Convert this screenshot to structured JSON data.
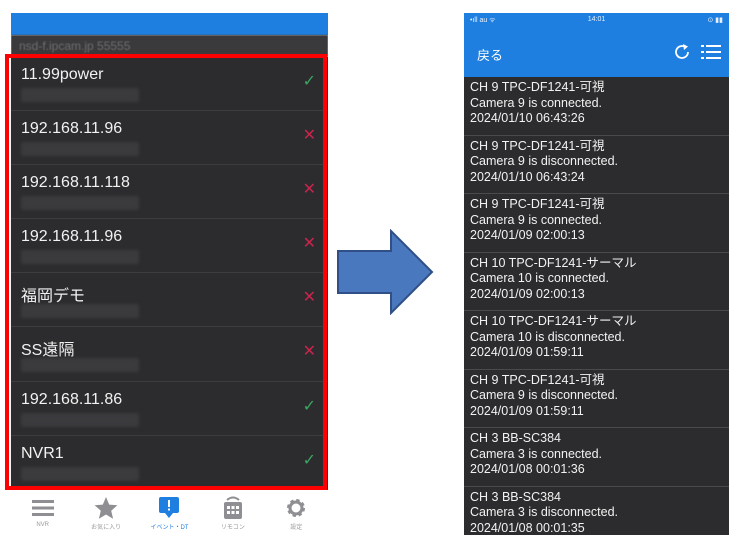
{
  "left_app": {
    "server_address": "nsd-f.ipcam.jp 55555",
    "devices": [
      {
        "name": "11.99power",
        "status": "connected",
        "status_glyph": "✓"
      },
      {
        "name": "192.168.11.96",
        "status": "disconnected",
        "status_glyph": "✕"
      },
      {
        "name": "192.168.11.118",
        "status": "disconnected",
        "status_glyph": "✕"
      },
      {
        "name": "192.168.11.96",
        "status": "disconnected",
        "status_glyph": "✕"
      },
      {
        "name": "福岡デモ",
        "status": "disconnected",
        "status_glyph": "✕"
      },
      {
        "name": "SS遠隔",
        "status": "disconnected",
        "status_glyph": "✕"
      },
      {
        "name": "192.168.11.86",
        "status": "connected",
        "status_glyph": "✓"
      },
      {
        "name": "NVR1",
        "status": "connected",
        "status_glyph": "✓"
      }
    ],
    "tabs": [
      {
        "label": "NVR",
        "icon": "list-icon",
        "active": false
      },
      {
        "label": "お気に入り",
        "icon": "star-icon",
        "active": false
      },
      {
        "label": "イベント・DT",
        "icon": "event-icon",
        "active": true
      },
      {
        "label": "リモコン",
        "icon": "remote-icon",
        "active": false
      },
      {
        "label": "設定",
        "icon": "gear-icon",
        "active": false
      }
    ]
  },
  "right_app": {
    "status_bar": {
      "left": "•ıll au ᯤ",
      "time": "14:01",
      "right": "⊙ ▮▮"
    },
    "nav": {
      "back_label": "戻る",
      "refresh_icon": "refresh-icon",
      "menu_icon": "list-icon"
    },
    "events": [
      {
        "title": "CH 9 TPC-DF1241-可視",
        "message": "Camera 9 is connected.",
        "timestamp": "2024/01/10 06:43:26"
      },
      {
        "title": "CH 9 TPC-DF1241-可視",
        "message": "Camera 9 is disconnected.",
        "timestamp": "2024/01/10 06:43:24"
      },
      {
        "title": "CH 9 TPC-DF1241-可視",
        "message": "Camera 9 is connected.",
        "timestamp": "2024/01/09 02:00:13"
      },
      {
        "title": "CH 10 TPC-DF1241-サーマル",
        "message": "Camera 10 is connected.",
        "timestamp": "2024/01/09 02:00:13"
      },
      {
        "title": "CH 10 TPC-DF1241-サーマル",
        "message": "Camera 10 is disconnected.",
        "timestamp": "2024/01/09 01:59:11"
      },
      {
        "title": "CH 9 TPC-DF1241-可視",
        "message": "Camera 9 is disconnected.",
        "timestamp": "2024/01/09 01:59:11"
      },
      {
        "title": "CH 3 BB-SC384",
        "message": "Camera 3 is connected.",
        "timestamp": "2024/01/08 00:01:36"
      },
      {
        "title": "CH 3 BB-SC384",
        "message": "Camera 3 is disconnected.",
        "timestamp": "2024/01/08 00:01:35"
      }
    ]
  },
  "colors": {
    "accent_blue": "#1f7fe0",
    "connected_green": "#3aa55f",
    "disconnected_red": "#c7254e",
    "highlight_frame": "#ff0000",
    "arrow_fill": "#4a78bf",
    "arrow_stroke": "#2f4f86",
    "list_bg": "#2c2c2e"
  }
}
